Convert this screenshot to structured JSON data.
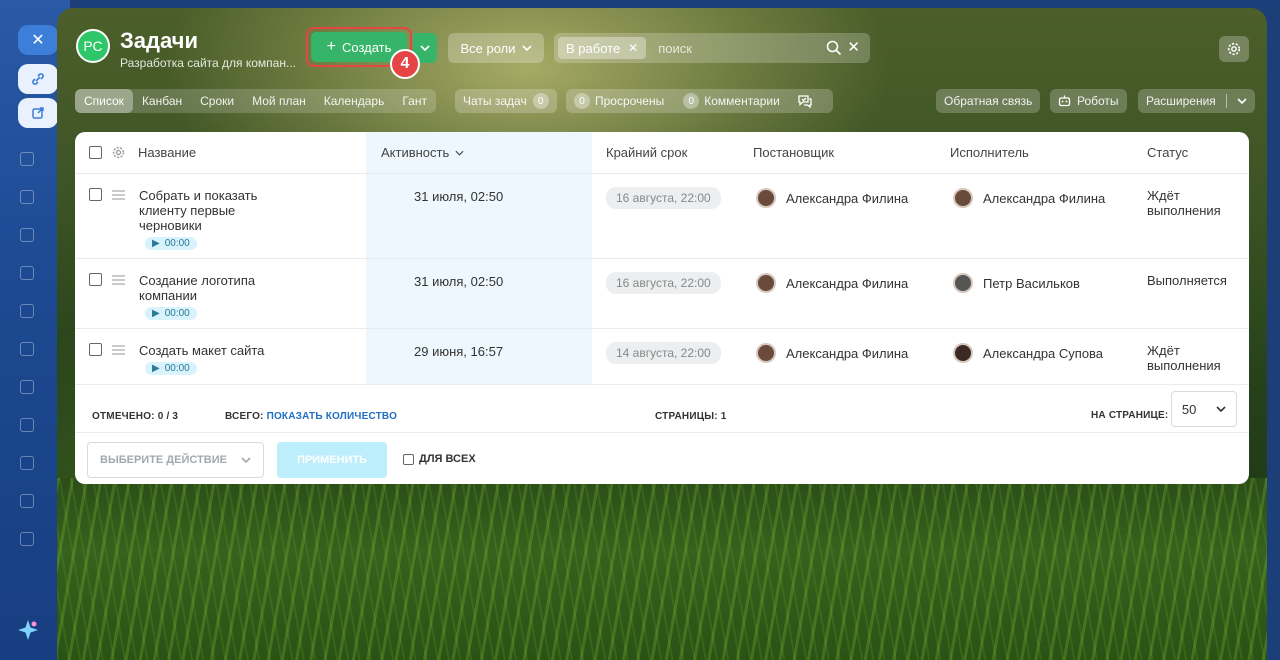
{
  "header": {
    "logo_text": "РС",
    "title": "Задачи",
    "subtitle": "Разработка сайта для компан...",
    "create_label": "Создать",
    "step_number": "4",
    "roles_label": "Все роли",
    "filter_chip": "В работе",
    "search_placeholder": "поиск"
  },
  "views": [
    "Список",
    "Канбан",
    "Сроки",
    "Мой план",
    "Календарь",
    "Гант"
  ],
  "toolbar": {
    "chats_label": "Чаты задач",
    "chats_count": "0",
    "overdue_count": "0",
    "overdue_label": "Просрочены",
    "comments_count": "0",
    "comments_label": "Комментарии",
    "feedback_label": "Обратная связь",
    "robots_label": "Роботы",
    "extensions_label": "Расширения"
  },
  "table": {
    "columns": {
      "name": "Название",
      "activity": "Активность",
      "deadline": "Крайний срок",
      "creator": "Постановщик",
      "assignee": "Исполнитель",
      "status": "Статус"
    },
    "rows": [
      {
        "name": "Собрать и показать клиенту первые черновики",
        "timer": "00:00",
        "activity": "31 июля, 02:50",
        "deadline": "16 августа, 22:00",
        "creator": "Александра Филина",
        "assignee": "Александра Филина",
        "status": "Ждёт выполнения"
      },
      {
        "name": "Создание логотипа компании",
        "timer": "00:00",
        "activity": "31 июля, 02:50",
        "deadline": "16 августа, 22:00",
        "creator": "Александра Филина",
        "assignee": "Петр Васильков",
        "status": "Выполняется"
      },
      {
        "name": "Создать макет сайта",
        "timer": "00:00",
        "activity": "29 июня, 16:57",
        "deadline": "14 августа, 22:00",
        "creator": "Александра Филина",
        "assignee": "Александра Супова",
        "status": "Ждёт выполнения"
      }
    ]
  },
  "footer": {
    "marked_label": "ОТМЕЧЕНО:",
    "marked_value": "0 / 3",
    "total_label": "ВСЕГО:",
    "total_link": "ПОКАЗАТЬ КОЛИЧЕСТВО",
    "pages_label": "СТРАНИЦЫ:",
    "pages_value": "1",
    "per_page_label": "НА СТРАНИЦЕ:",
    "per_page_value": "50",
    "action_placeholder": "ВЫБЕРИТЕ ДЕЙСТВИЕ",
    "apply_label": "ПРИМЕНИТЬ",
    "for_all_label": "ДЛЯ ВСЕХ"
  },
  "colors": {
    "accent_green": "#36b56a",
    "highlight_red": "#e64545",
    "link_blue": "#1f6fc2"
  }
}
